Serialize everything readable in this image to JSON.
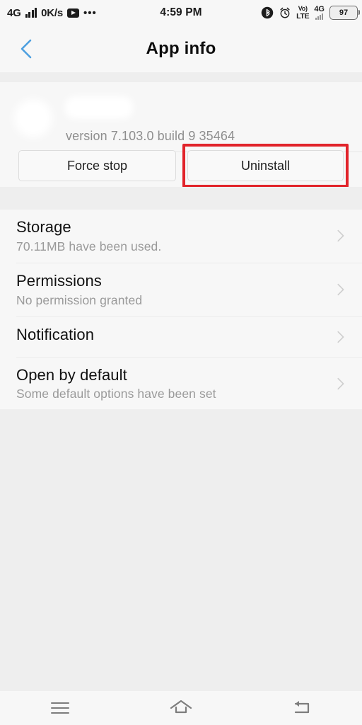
{
  "status_bar": {
    "network_type": "4G",
    "signal_icon": "signal-bars-icon",
    "data_rate": "0K/s",
    "media_icon": "youtube-play-icon",
    "overflow_icon": "more-dots-icon",
    "time": "4:59 PM",
    "bluetooth_icon": "bluetooth-icon",
    "alarm_icon": "alarm-clock-icon",
    "volte_top": "Vo)",
    "volte_bottom": "LTE",
    "network_type_right": "4G",
    "battery_level": "97"
  },
  "header": {
    "back_icon": "back-chevron-icon",
    "title": "App info"
  },
  "app_summary": {
    "app_icon": "app-icon-redacted",
    "app_name": "",
    "version": "version 7.103.0 build 9 35464",
    "buttons": {
      "force_stop": "Force stop",
      "uninstall": "Uninstall"
    },
    "highlight_color": "#e1232a",
    "highlighted_button": "Uninstall"
  },
  "settings_list": [
    {
      "title": "Storage",
      "subtitle": "70.11MB have been used.",
      "chevron": "chevron-right-icon"
    },
    {
      "title": "Permissions",
      "subtitle": "No permission granted",
      "chevron": "chevron-right-icon"
    },
    {
      "title": "Notification",
      "subtitle": "",
      "chevron": "chevron-right-icon"
    },
    {
      "title": "Open by default",
      "subtitle": "Some default options have been set",
      "chevron": "chevron-right-icon"
    }
  ],
  "nav_bar": {
    "menu_icon": "menu-icon",
    "home_icon": "home-icon",
    "back_icon": "back-arrow-icon"
  }
}
